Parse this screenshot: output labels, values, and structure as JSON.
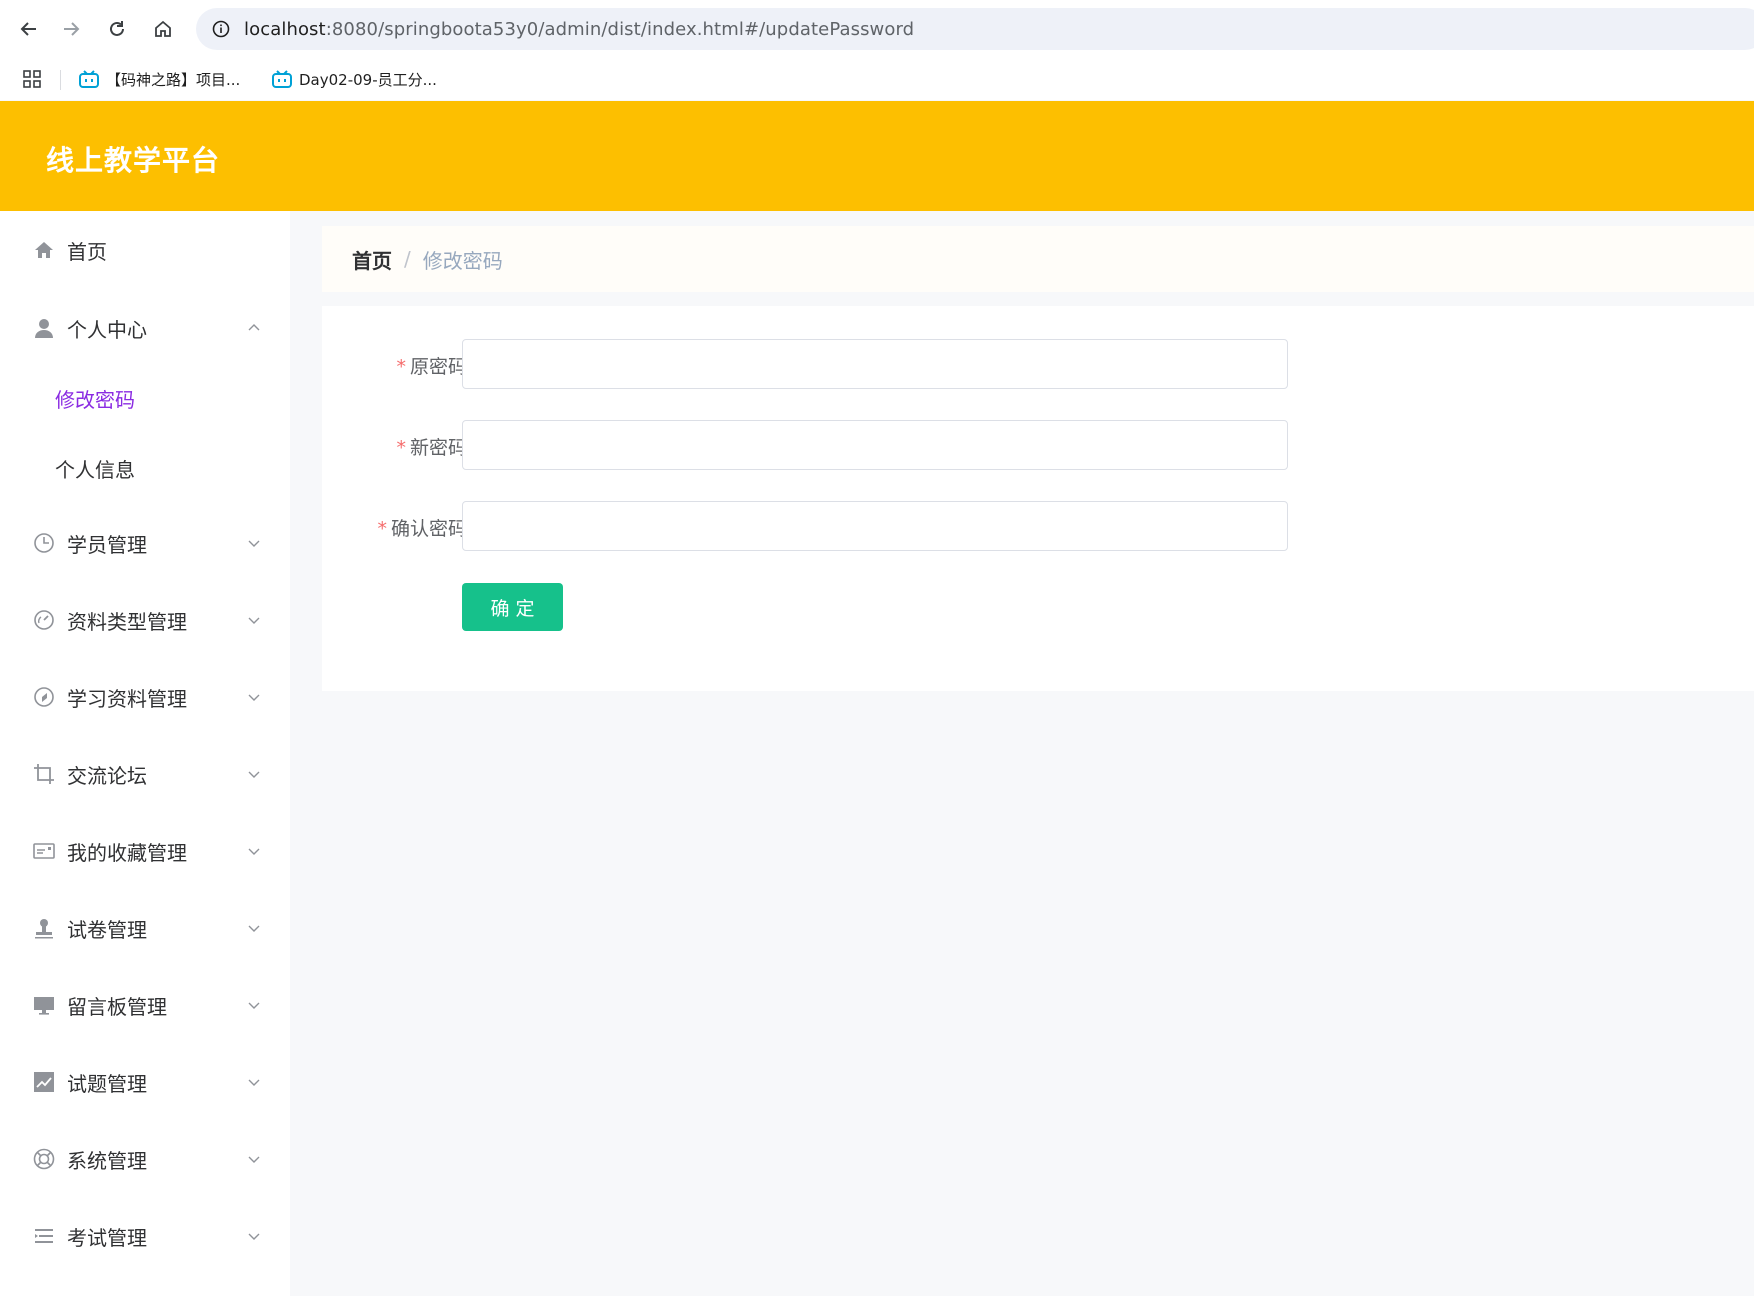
{
  "browser": {
    "url_host": "localhost",
    "url_rest": ":8080/springboota53y0/admin/dist/index.html#/updatePassword",
    "bookmarks": [
      {
        "label": "【码神之路】项目..."
      },
      {
        "label": "Day02-09-员工分..."
      }
    ]
  },
  "app": {
    "title": "线上教学平台"
  },
  "sidebar": {
    "items": [
      {
        "label": "首页",
        "icon": "home-icon"
      },
      {
        "label": "个人中心",
        "icon": "user-icon",
        "expanded": true,
        "children": [
          {
            "label": "修改密码",
            "active": true
          },
          {
            "label": "个人信息",
            "active": false
          }
        ]
      },
      {
        "label": "学员管理",
        "icon": "clock-icon"
      },
      {
        "label": "资料类型管理",
        "icon": "gauge-icon"
      },
      {
        "label": "学习资料管理",
        "icon": "compass-icon"
      },
      {
        "label": "交流论坛",
        "icon": "crop-icon"
      },
      {
        "label": "我的收藏管理",
        "icon": "postcard-icon"
      },
      {
        "label": "试卷管理",
        "icon": "stamp-icon"
      },
      {
        "label": "留言板管理",
        "icon": "monitor-icon"
      },
      {
        "label": "试题管理",
        "icon": "chart-icon"
      },
      {
        "label": "系统管理",
        "icon": "lifebuoy-icon"
      },
      {
        "label": "考试管理",
        "icon": "list-icon"
      }
    ]
  },
  "breadcrumb": {
    "home": "首页",
    "separator": "/",
    "current": "修改密码"
  },
  "form": {
    "fields": [
      {
        "label": "原密码",
        "required": "*",
        "value": ""
      },
      {
        "label": "新密码",
        "required": "*",
        "value": ""
      },
      {
        "label": "确认密码",
        "required": "*",
        "value": ""
      }
    ],
    "submit_label": "确定"
  },
  "colors": {
    "header": "#fdbf00",
    "active_submenu": "#8a2be2",
    "submit": "#16c18b",
    "required": "#f56c6c"
  }
}
